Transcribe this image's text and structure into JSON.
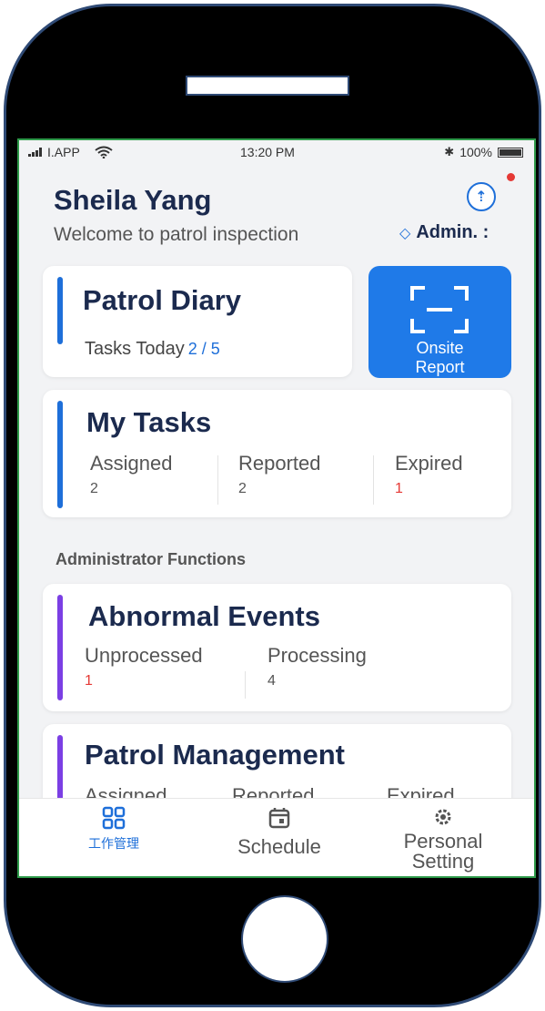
{
  "status_bar": {
    "carrier": "I.APP",
    "time": "13:20 PM",
    "battery": "100%"
  },
  "header": {
    "user_name": "Sheila Yang",
    "welcome": "Welcome to patrol inspection",
    "role": "Admin. :",
    "upload_icon": "upload-icon"
  },
  "patrol_diary": {
    "title": "Patrol Diary",
    "tasks_label": "Tasks Today",
    "tasks_count": "2 / 5"
  },
  "onsite_report": {
    "line1": "Onsite",
    "line2": "Report",
    "icon": "scan-icon"
  },
  "my_tasks": {
    "title": "My Tasks",
    "stats": [
      {
        "label": "Assigned",
        "value": "2"
      },
      {
        "label": "Reported",
        "value": "2"
      },
      {
        "label": "Expired",
        "value": "1"
      }
    ]
  },
  "admin_section_label": "Administrator Functions",
  "abnormal_events": {
    "title": "Abnormal Events",
    "stats": [
      {
        "label": "Unprocessed",
        "value": "1"
      },
      {
        "label": "Processing",
        "value": "4"
      }
    ]
  },
  "patrol_management": {
    "title": "Patrol Management",
    "stats": [
      {
        "label": "Assigned"
      },
      {
        "label": "Reported"
      },
      {
        "label": "Expired"
      }
    ]
  },
  "bottom_nav": {
    "items": [
      {
        "label": "工作管理",
        "icon": "dashboard-icon",
        "active": true
      },
      {
        "label": "Schedule",
        "icon": "calendar-icon",
        "active": false
      },
      {
        "label_line1": "Personal",
        "label_line2": "Setting",
        "icon": "gear-icon",
        "active": false
      }
    ]
  },
  "colors": {
    "primary_blue": "#1e6fd9",
    "button_blue": "#1f7ae8",
    "accent_purple": "#7b3fe4",
    "alert_red": "#e53935",
    "title_navy": "#1b2a4e",
    "screen_border_green": "#2e9a4a"
  }
}
